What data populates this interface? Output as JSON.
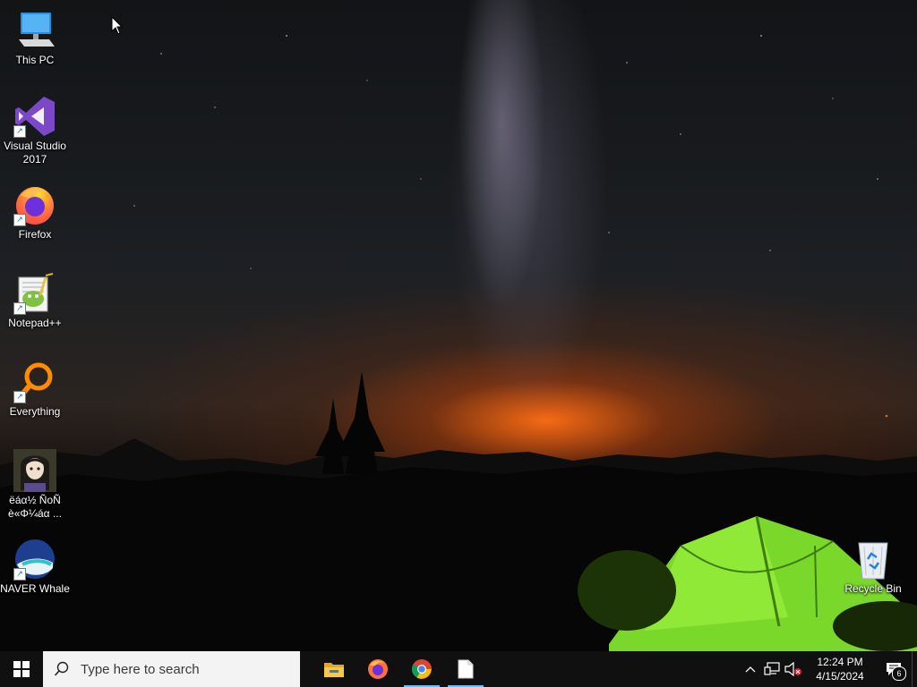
{
  "desktop": {
    "icons": [
      {
        "label": "This PC",
        "icon": "computer-icon",
        "shortcut": false
      },
      {
        "label": "Visual Studio 2017",
        "icon": "visual-studio-icon",
        "shortcut": true
      },
      {
        "label": "Firefox",
        "icon": "firefox-icon",
        "shortcut": true
      },
      {
        "label": "Notepad++",
        "icon": "notepad-plus-plus-icon",
        "shortcut": true
      },
      {
        "label": "Everything",
        "icon": "everything-search-icon",
        "shortcut": true
      },
      {
        "label": "ëáα½ ÑoÑ\nè«Φ¼áα ...",
        "icon": "avatar-image-icon",
        "shortcut": false
      },
      {
        "label": "NAVER Whale",
        "icon": "naver-whale-icon",
        "shortcut": true
      },
      {
        "label": "Recycle Bin",
        "icon": "recycle-bin-icon",
        "shortcut": false
      }
    ]
  },
  "taskbar": {
    "start_icon": "windows-start-icon",
    "search_placeholder": "Type here to search",
    "apps": [
      {
        "name": "File Explorer",
        "icon": "file-explorer-icon",
        "active": false
      },
      {
        "name": "Firefox",
        "icon": "firefox-icon",
        "active": false
      },
      {
        "name": "Google Chrome",
        "icon": "chrome-icon",
        "active": true
      },
      {
        "name": "Document",
        "icon": "document-icon",
        "active": true
      }
    ],
    "tray": {
      "icons": [
        "chevron-up-icon",
        "network-icon",
        "volume-muted-icon"
      ],
      "time": "12:24 PM",
      "date": "4/15/2024",
      "notification_count": "6"
    }
  },
  "colors": {
    "taskbar_bg": "#101010",
    "search_bg": "#f3f3f3",
    "active_indicator": "#76b9ed"
  }
}
